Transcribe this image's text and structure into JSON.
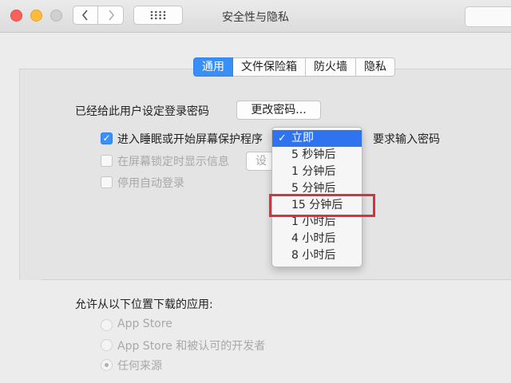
{
  "window": {
    "title": "安全性与隐私"
  },
  "toolbar": {
    "back": "‹",
    "forward": "›",
    "grid": "⠿"
  },
  "tabs": [
    {
      "label": "通用",
      "active": true
    },
    {
      "label": "文件保险箱",
      "active": false
    },
    {
      "label": "防火墙",
      "active": false
    },
    {
      "label": "隐私",
      "active": false
    }
  ],
  "general": {
    "password_label": "已经给此用户设定登录密码",
    "change_password": "更改密码...",
    "sleep_prefix": "进入睡眠或开始屏幕保护程序",
    "sleep_suffix": "要求输入密码",
    "show_message": "在屏幕锁定时显示信息",
    "set_button": "设",
    "disable_autologin": "停用自动登录",
    "require_password_checked": true
  },
  "dropdown": {
    "selected": "立即",
    "options": [
      "立即",
      "5 秒钟后",
      "1 分钟后",
      "5 分钟后",
      "15 分钟后",
      "1 小时后",
      "4 小时后",
      "8 小时后"
    ]
  },
  "downloads": {
    "label": "允许从以下位置下载的应用:",
    "options": [
      {
        "label": "App Store",
        "selected": false
      },
      {
        "label": "App Store 和被认可的开发者",
        "selected": false
      },
      {
        "label": "任何来源",
        "selected": true
      }
    ]
  },
  "colors": {
    "accent": "#3a8ff6",
    "menu_selection": "#2f73ee",
    "annotation": "#d8333d"
  }
}
